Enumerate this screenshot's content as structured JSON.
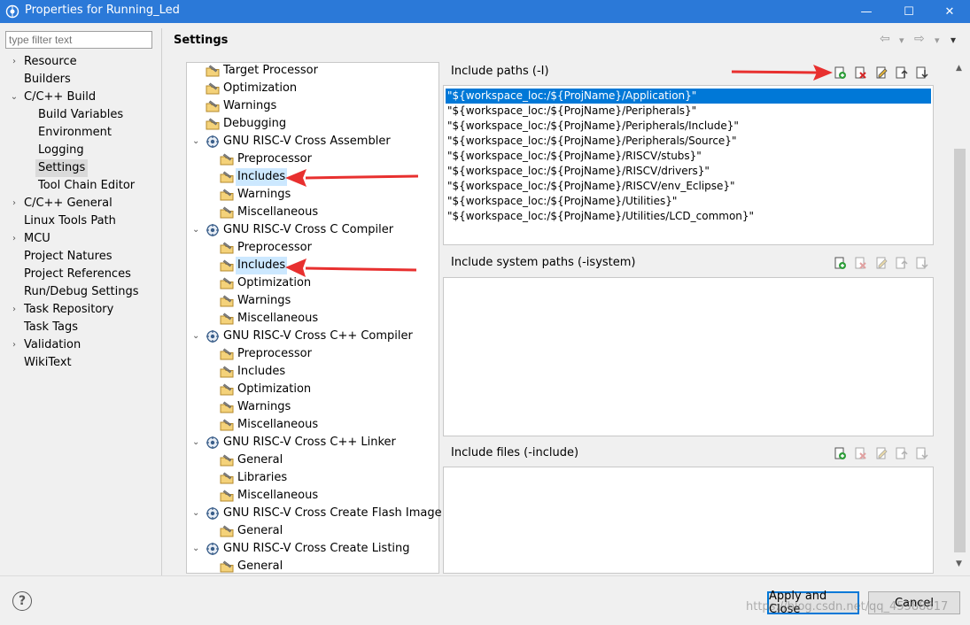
{
  "window": {
    "title": "Properties for Running_Led",
    "controls": {
      "minimize": "—",
      "maximize": "☐",
      "close": "✕"
    }
  },
  "filter": {
    "placeholder": "type filter text"
  },
  "nav": [
    {
      "label": "Resource",
      "twist": "›"
    },
    {
      "label": "Builders",
      "twist": ""
    },
    {
      "label": "C/C++ Build",
      "twist": "⌄"
    },
    {
      "label": "Build Variables",
      "twist": ""
    },
    {
      "label": "Environment",
      "twist": ""
    },
    {
      "label": "Logging",
      "twist": ""
    },
    {
      "label": "Settings",
      "twist": ""
    },
    {
      "label": "Tool Chain Editor",
      "twist": ""
    },
    {
      "label": "C/C++ General",
      "twist": "›"
    },
    {
      "label": "Linux Tools Path",
      "twist": ""
    },
    {
      "label": "MCU",
      "twist": "›"
    },
    {
      "label": "Project Natures",
      "twist": ""
    },
    {
      "label": "Project References",
      "twist": ""
    },
    {
      "label": "Run/Debug Settings",
      "twist": ""
    },
    {
      "label": "Task Repository",
      "twist": "›"
    },
    {
      "label": "Task Tags",
      "twist": ""
    },
    {
      "label": "Validation",
      "twist": "›"
    },
    {
      "label": "WikiText",
      "twist": ""
    }
  ],
  "header": {
    "title": "Settings",
    "back": "⇦",
    "forward": "⇨",
    "dropdown": "▾",
    "menu": "▾"
  },
  "tree": [
    {
      "label": "Target Processor"
    },
    {
      "label": "Optimization"
    },
    {
      "label": "Warnings"
    },
    {
      "label": "Debugging"
    },
    {
      "label": "GNU RISC-V Cross Assembler",
      "twist": "⌄"
    },
    {
      "label": "Preprocessor"
    },
    {
      "label": "Includes"
    },
    {
      "label": "Warnings"
    },
    {
      "label": "Miscellaneous"
    },
    {
      "label": "GNU RISC-V Cross C Compiler",
      "twist": "⌄"
    },
    {
      "label": "Preprocessor"
    },
    {
      "label": "Includes"
    },
    {
      "label": "Optimization"
    },
    {
      "label": "Warnings"
    },
    {
      "label": "Miscellaneous"
    },
    {
      "label": "GNU RISC-V Cross C++ Compiler",
      "twist": "⌄"
    },
    {
      "label": "Preprocessor"
    },
    {
      "label": "Includes"
    },
    {
      "label": "Optimization"
    },
    {
      "label": "Warnings"
    },
    {
      "label": "Miscellaneous"
    },
    {
      "label": "GNU RISC-V Cross C++ Linker",
      "twist": "⌄"
    },
    {
      "label": "General"
    },
    {
      "label": "Libraries"
    },
    {
      "label": "Miscellaneous"
    },
    {
      "label": "GNU RISC-V Cross Create Flash Image",
      "twist": "⌄"
    },
    {
      "label": "General"
    },
    {
      "label": "GNU RISC-V Cross Create Listing",
      "twist": "⌄"
    },
    {
      "label": "General"
    }
  ],
  "include_paths": {
    "title": "Include paths (-I)",
    "items": [
      "\"${workspace_loc:/${ProjName}/Application}\"",
      "\"${workspace_loc:/${ProjName}/Peripherals}\"",
      "\"${workspace_loc:/${ProjName}/Peripherals/Include}\"",
      "\"${workspace_loc:/${ProjName}/Peripherals/Source}\"",
      "\"${workspace_loc:/${ProjName}/RISCV/stubs}\"",
      "\"${workspace_loc:/${ProjName}/RISCV/drivers}\"",
      "\"${workspace_loc:/${ProjName}/RISCV/env_Eclipse}\"",
      "\"${workspace_loc:/${ProjName}/Utilities}\"",
      "\"${workspace_loc:/${ProjName}/Utilities/LCD_common}\""
    ]
  },
  "system_paths": {
    "title": "Include system paths (-isystem)"
  },
  "include_files": {
    "title": "Include files (-include)"
  },
  "buttons": {
    "apply_close": "Apply and Close",
    "cancel": "Cancel",
    "help": "?"
  },
  "watermark": "https://blog.csdn.net/qq_45588817",
  "colors": {
    "titlebar": "#2b79d8",
    "selection": "#0078d7",
    "tree_selection": "#cce8ff",
    "annotation_arrow": "#e8302f"
  }
}
